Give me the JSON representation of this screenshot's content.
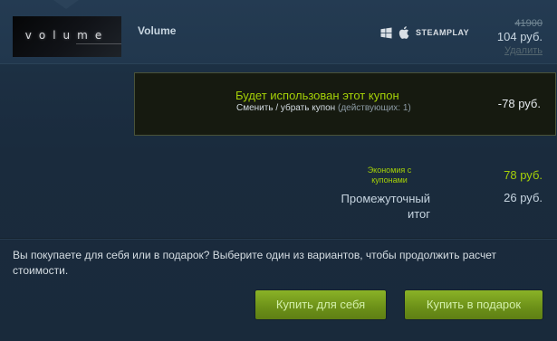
{
  "cart_item": {
    "capsule_text": "volume",
    "title": "Volume",
    "platforms": {
      "icons": [
        "windows-icon",
        "apple-icon"
      ],
      "steamplay_label": "STEAMPLAY"
    },
    "original_price": "41900",
    "price": "104 руб.",
    "remove_label": "Удалить"
  },
  "coupon": {
    "title": "Будет использован этот купон",
    "change_label": "Сменить / убрать купон",
    "active_count": "(действующих: 1)",
    "discount": "-78 руб."
  },
  "summary": {
    "savings_label": "Экономия с купонами",
    "savings_value": "78 руб.",
    "subtotal_label": "Промежуточный итог",
    "subtotal_value": "26 руб."
  },
  "purchase": {
    "question": "Вы покупаете для себя или в подарок? Выберите один из вариантов, чтобы продолжить расчет стоимости.",
    "buy_self_label": "Купить для себя",
    "buy_gift_label": "Купить в подарок"
  },
  "colors": {
    "background": "#1b2838",
    "accent_green": "#a4d007",
    "button_green": "#6c9018"
  }
}
